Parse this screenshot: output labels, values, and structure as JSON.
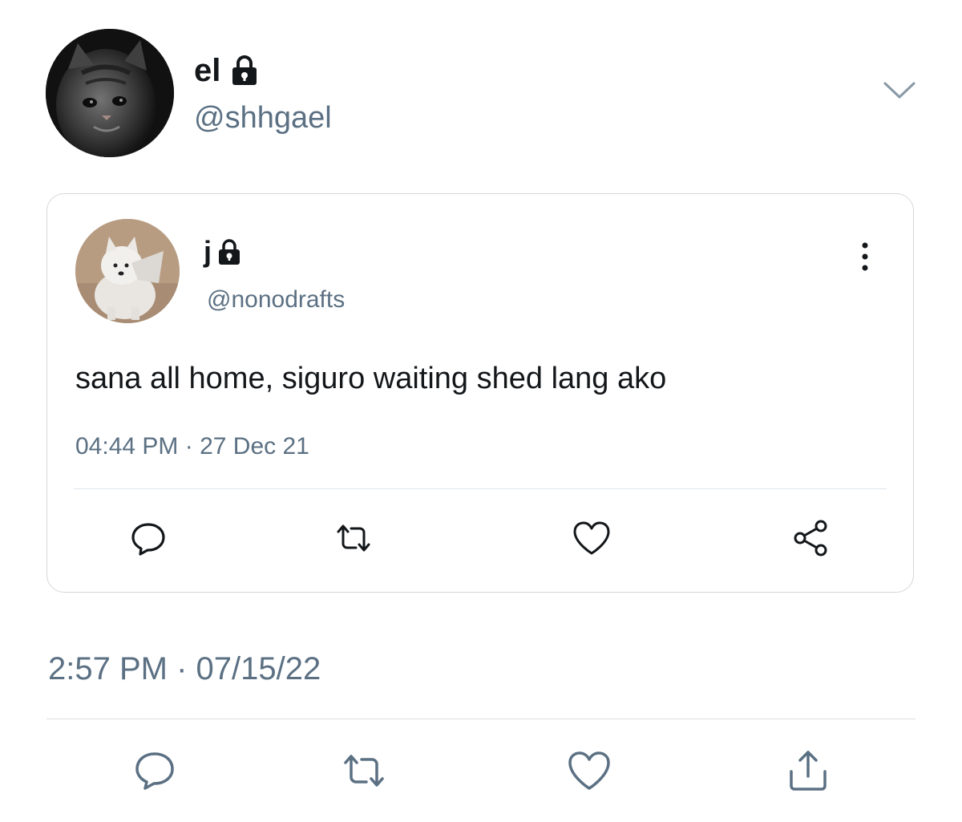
{
  "tweet": {
    "display_name": "el",
    "handle": "@shhgael",
    "timestamp": "2:57 PM · 07/15/22",
    "actions": [
      "reply-icon",
      "retweet-icon",
      "like-icon",
      "share-icon"
    ]
  },
  "quoted": {
    "display_name": "j",
    "handle": "@nonodrafts",
    "text": "sana all home, siguro waiting shed lang ako",
    "timestamp": "04:44 PM · 27 Dec 21",
    "actions": [
      "reply-icon",
      "retweet-icon",
      "like-icon",
      "share-nodes-icon"
    ]
  },
  "colors": {
    "secondary_text": "#5b7083",
    "border": "#d4d8dc",
    "icon": "#5b7083"
  }
}
